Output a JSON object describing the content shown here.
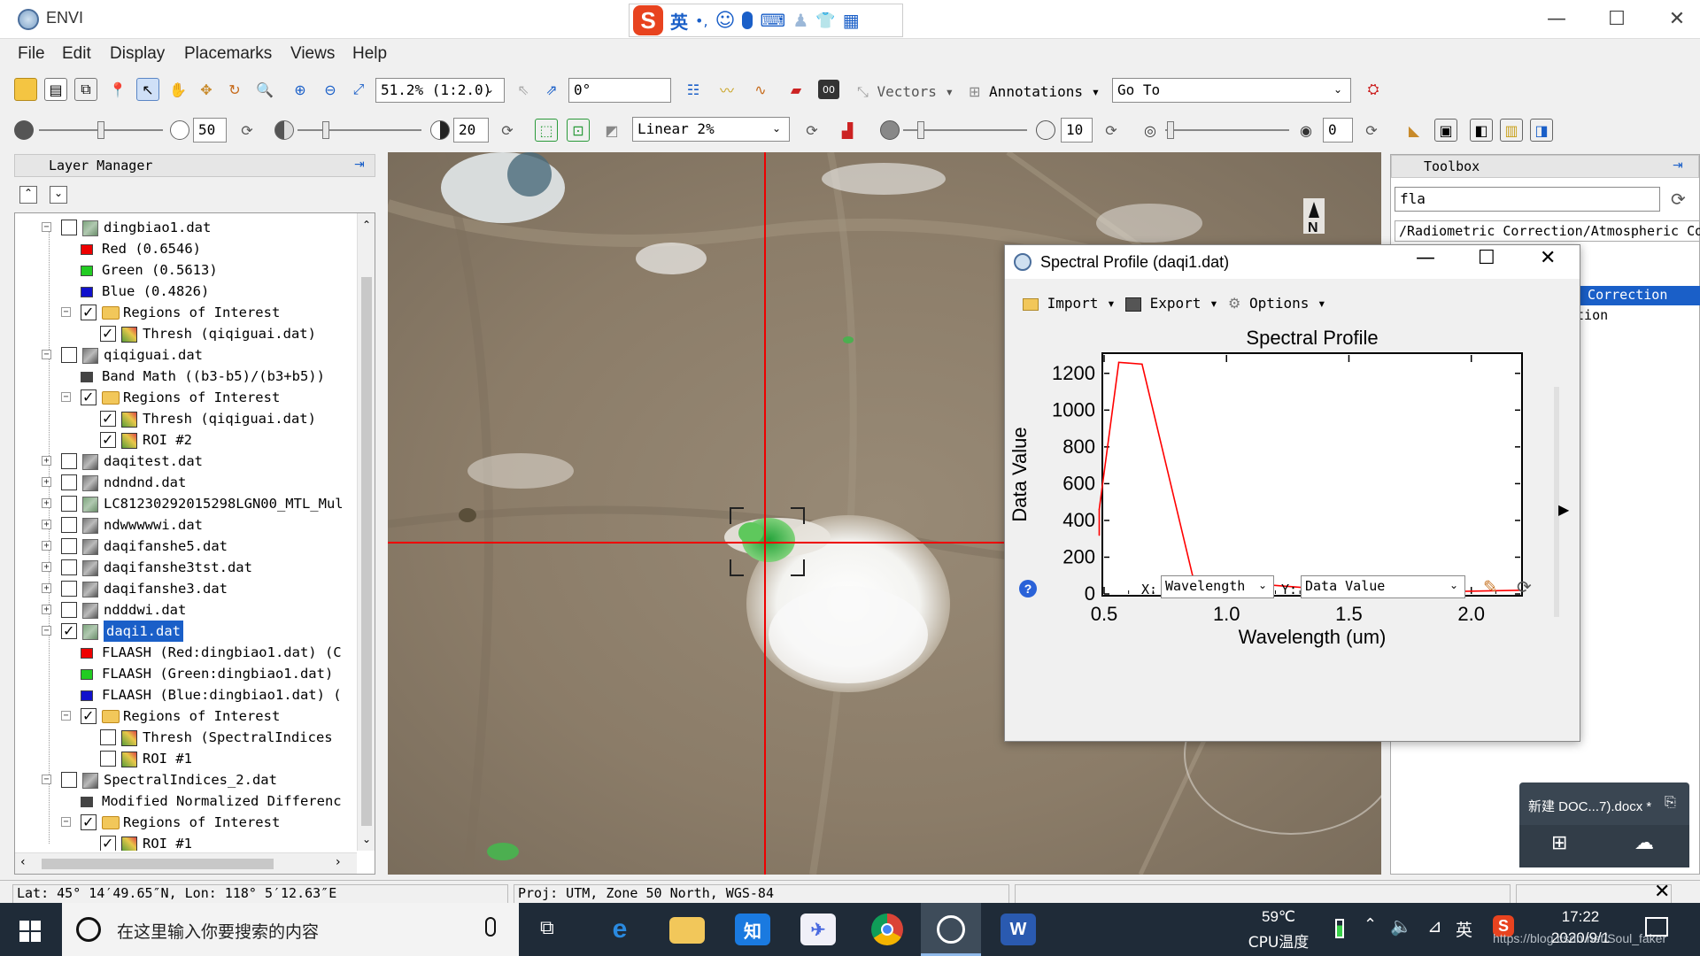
{
  "window": {
    "title": "ENVI",
    "minimize": "—",
    "maximize": "☐",
    "close": "✕"
  },
  "ime": {
    "label": "英",
    "icons": [
      "•,",
      "☺",
      "🎤",
      "⌨",
      "♟",
      "👕",
      "▦"
    ]
  },
  "menu": [
    "File",
    "Edit",
    "Display",
    "Placemarks",
    "Views",
    "Help"
  ],
  "toolbar1": {
    "zoom": "51.2% (1:2.0)",
    "rotation": "0°",
    "vectors": "Vectors",
    "annotations": "Annotations",
    "goto": "Go To"
  },
  "toolbar2": {
    "brightness": "50",
    "contrast": "20",
    "stretch": "Linear 2%",
    "sharpen": "10",
    "transparency": "0"
  },
  "layer_manager": {
    "title": "Layer Manager",
    "rows": [
      {
        "t": "dingbiao1.dat",
        "lvl": 0,
        "exp": "−",
        "cb": "off",
        "icon": "rgb",
        "sel": false
      },
      {
        "t": "Red (0.6546)",
        "lvl": 1,
        "exp": "",
        "cb": "none",
        "icon": "red",
        "sel": false
      },
      {
        "t": "Green (0.5613)",
        "lvl": 1,
        "exp": "",
        "cb": "none",
        "icon": "green",
        "sel": false
      },
      {
        "t": "Blue (0.4826)",
        "lvl": 1,
        "exp": "",
        "cb": "none",
        "icon": "blue",
        "sel": false
      },
      {
        "t": "Regions of Interest",
        "lvl": 1,
        "exp": "−",
        "cb": "on",
        "icon": "folder",
        "sel": false
      },
      {
        "t": "Thresh (qiqiguai.dat)",
        "lvl": 2,
        "exp": "",
        "cb": "on",
        "icon": "roi",
        "sel": false
      },
      {
        "t": "qiqiguai.dat",
        "lvl": 0,
        "exp": "−",
        "cb": "off",
        "icon": "gray",
        "sel": false
      },
      {
        "t": "Band Math ((b3-b5)/(b3+b5))",
        "lvl": 1,
        "exp": "",
        "cb": "none",
        "icon": "grayband",
        "sel": false
      },
      {
        "t": "Regions of Interest",
        "lvl": 1,
        "exp": "−",
        "cb": "on",
        "icon": "folder",
        "sel": false
      },
      {
        "t": "Thresh (qiqiguai.dat)",
        "lvl": 2,
        "exp": "",
        "cb": "on",
        "icon": "roi",
        "sel": false
      },
      {
        "t": "ROI #2",
        "lvl": 2,
        "exp": "",
        "cb": "on",
        "icon": "roi",
        "sel": false
      },
      {
        "t": "daqitest.dat",
        "lvl": 0,
        "exp": "+",
        "cb": "off",
        "icon": "gray",
        "sel": false
      },
      {
        "t": "ndndnd.dat",
        "lvl": 0,
        "exp": "+",
        "cb": "off",
        "icon": "gray",
        "sel": false
      },
      {
        "t": "LC81230292015298LGN00_MTL_Mul",
        "lvl": 0,
        "exp": "+",
        "cb": "off",
        "icon": "rgb",
        "sel": false
      },
      {
        "t": "ndwwwwwi.dat",
        "lvl": 0,
        "exp": "+",
        "cb": "off",
        "icon": "gray",
        "sel": false
      },
      {
        "t": "daqifanshe5.dat",
        "lvl": 0,
        "exp": "+",
        "cb": "off",
        "icon": "gray",
        "sel": false
      },
      {
        "t": "daqifanshe3tst.dat",
        "lvl": 0,
        "exp": "+",
        "cb": "off",
        "icon": "gray",
        "sel": false
      },
      {
        "t": "daqifanshe3.dat",
        "lvl": 0,
        "exp": "+",
        "cb": "off",
        "icon": "gray",
        "sel": false
      },
      {
        "t": "ndddwi.dat",
        "lvl": 0,
        "exp": "+",
        "cb": "off",
        "icon": "gray",
        "sel": false
      },
      {
        "t": "daqi1.dat",
        "lvl": 0,
        "exp": "−",
        "cb": "on",
        "icon": "rgb",
        "sel": true
      },
      {
        "t": "FLAASH (Red:dingbiao1.dat) (C",
        "lvl": 1,
        "exp": "",
        "cb": "none",
        "icon": "red",
        "sel": false
      },
      {
        "t": "FLAASH (Green:dingbiao1.dat)",
        "lvl": 1,
        "exp": "",
        "cb": "none",
        "icon": "green",
        "sel": false
      },
      {
        "t": "FLAASH (Blue:dingbiao1.dat) (",
        "lvl": 1,
        "exp": "",
        "cb": "none",
        "icon": "blue",
        "sel": false
      },
      {
        "t": "Regions of Interest",
        "lvl": 1,
        "exp": "−",
        "cb": "on",
        "icon": "folder",
        "sel": false
      },
      {
        "t": "Thresh (SpectralIndices",
        "lvl": 2,
        "exp": "",
        "cb": "off",
        "icon": "roi",
        "sel": false
      },
      {
        "t": "ROI #1",
        "lvl": 2,
        "exp": "",
        "cb": "off",
        "icon": "roi",
        "sel": false
      },
      {
        "t": "SpectralIndices_2.dat",
        "lvl": 0,
        "exp": "−",
        "cb": "off",
        "icon": "gray",
        "sel": false
      },
      {
        "t": "Modified Normalized Differenc",
        "lvl": 1,
        "exp": "",
        "cb": "none",
        "icon": "grayband",
        "sel": false
      },
      {
        "t": "Regions of Interest",
        "lvl": 1,
        "exp": "−",
        "cb": "on",
        "icon": "folder",
        "sel": false
      },
      {
        "t": "ROI #1",
        "lvl": 2,
        "exp": "",
        "cb": "on",
        "icon": "roi",
        "sel": false
      }
    ]
  },
  "toolbox": {
    "title": "Toolbox",
    "search": "fla",
    "path": "/Radiometric Correction/Atmospheric Cor",
    "item1": "c Correction",
    "item2": "ction"
  },
  "spectral": {
    "title": "Spectral Profile (daqi1.dat)",
    "import": "Import",
    "export": "Export",
    "options": "Options",
    "x_label": "X:",
    "x_value": "Wavelength",
    "y_label": "Y:",
    "y_value": "Data Value",
    "help": "?"
  },
  "chart_data": {
    "type": "line",
    "title": "Spectral Profile",
    "xlabel": "Wavelength (um)",
    "ylabel": "Data Value",
    "xlim": [
      0.5,
      2.2
    ],
    "ylim": [
      0,
      1300
    ],
    "xticks": [
      "0.5",
      "1.0",
      "1.5",
      "2.0"
    ],
    "yticks": [
      "0",
      "200",
      "400",
      "600",
      "800",
      "1000",
      "1200"
    ],
    "x": [
      0.48,
      0.48,
      0.56,
      0.655,
      0.865,
      1.61,
      2.2
    ],
    "values": [
      320,
      460,
      1260,
      1250,
      80,
      5,
      20
    ],
    "series_color": "#ff0000"
  },
  "status": {
    "latlon": "Lat: 45° 14′49.65″N, Lon: 118° 5′12.63″E",
    "proj": "Proj: UTM, Zone 50 North, WGS-84"
  },
  "notify": {
    "title": "新建 DOC...7).docx *"
  },
  "taskbar": {
    "search": "在这里输入你要搜索的内容",
    "temp": "59℃",
    "temp_label": "CPU温度",
    "lang": "英",
    "time": "17:22",
    "date": "2020/9/1",
    "watermark": "https://blog.csdn.net/Soul_faker"
  }
}
